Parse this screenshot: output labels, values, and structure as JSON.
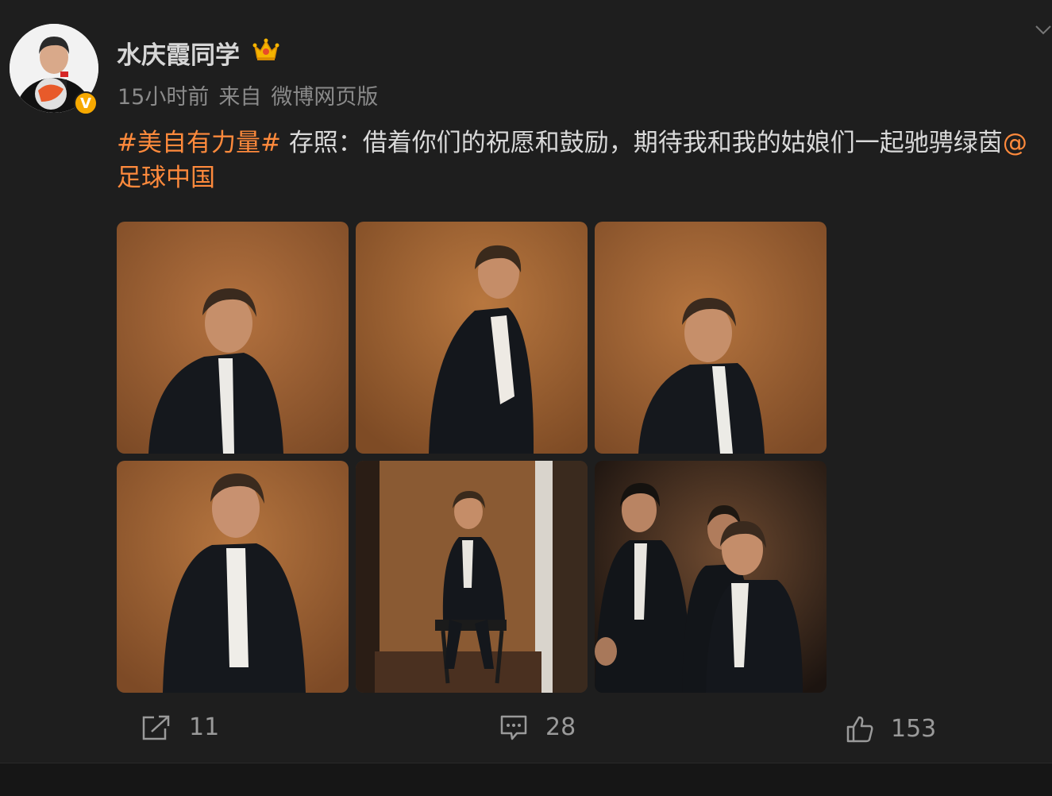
{
  "post": {
    "author": {
      "name": "水庆霞同学",
      "verified_badge": "V",
      "avatar_icon": "avatar-photo",
      "badge_icon": "crown-icon"
    },
    "meta": {
      "time": "15小时前",
      "source_prefix": "来自",
      "source": "微博网页版"
    },
    "content": {
      "hashtag": "#美自有力量#",
      "text": "存照：借着你们的祝愿和鼓励，期待我和我的姑娘们一起驰骋绿茵",
      "mention": "@足球中国"
    },
    "images": [
      {
        "icon": "photo-portrait-1"
      },
      {
        "icon": "photo-portrait-2"
      },
      {
        "icon": "photo-portrait-3"
      },
      {
        "icon": "photo-portrait-4"
      },
      {
        "icon": "photo-seated"
      },
      {
        "icon": "photo-group"
      }
    ],
    "actions": {
      "share_count": "11",
      "comment_count": "28",
      "like_count": "153"
    }
  },
  "colors": {
    "background": "#1e1e1e",
    "link": "#ff8a3c",
    "text": "#d9d9d9",
    "muted": "#8a8a8a",
    "verified": "#f7a900"
  }
}
